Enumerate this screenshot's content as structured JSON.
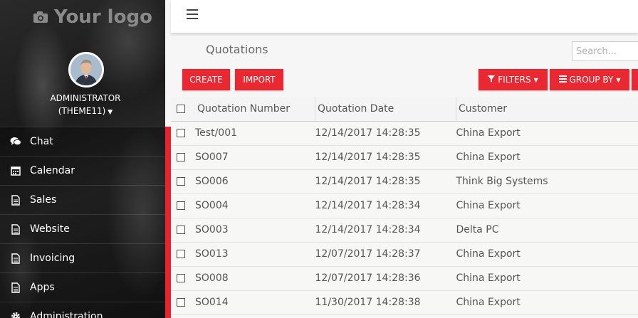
{
  "sidebar": {
    "logo_text": "Your logo",
    "logo_icon": "camera-icon",
    "user": {
      "name": "ADMINISTRATOR",
      "company": "(THEME11)"
    },
    "items": [
      {
        "label": "Chat",
        "icon": "chat-icon"
      },
      {
        "label": "Calendar",
        "icon": "calendar-icon"
      },
      {
        "label": "Sales",
        "icon": "document-icon"
      },
      {
        "label": "Website",
        "icon": "document-icon"
      },
      {
        "label": "Invoicing",
        "icon": "document-icon"
      },
      {
        "label": "Apps",
        "icon": "document-icon"
      },
      {
        "label": "Administration",
        "icon": "gear-icon"
      }
    ]
  },
  "topbar": {
    "menu_icon": "hamburger-icon"
  },
  "page": {
    "title": "Quotations"
  },
  "search": {
    "placeholder": "Search..."
  },
  "buttons": {
    "create": "CREATE",
    "import": "IMPORT",
    "filters": "FILTERS",
    "group_by": "GROUP BY"
  },
  "table": {
    "columns": [
      "Quotation Number",
      "Quotation Date",
      "Customer"
    ],
    "rows": [
      [
        "Test/001",
        "12/14/2017 14:28:35",
        "China Export"
      ],
      [
        "SO007",
        "12/14/2017 14:28:35",
        "China Export"
      ],
      [
        "SO006",
        "12/14/2017 14:28:35",
        "Think Big Systems"
      ],
      [
        "SO004",
        "12/14/2017 14:28:34",
        "China Export"
      ],
      [
        "SO003",
        "12/14/2017 14:28:34",
        "Delta PC"
      ],
      [
        "SO013",
        "12/07/2017 14:28:37",
        "China Export"
      ],
      [
        "SO008",
        "12/07/2017 14:28:36",
        "China Export"
      ],
      [
        "SO014",
        "11/30/2017 14:28:38",
        "China Export"
      ]
    ]
  },
  "colors": {
    "accent": "#ea2831",
    "sidebar_bg": "#222222"
  }
}
